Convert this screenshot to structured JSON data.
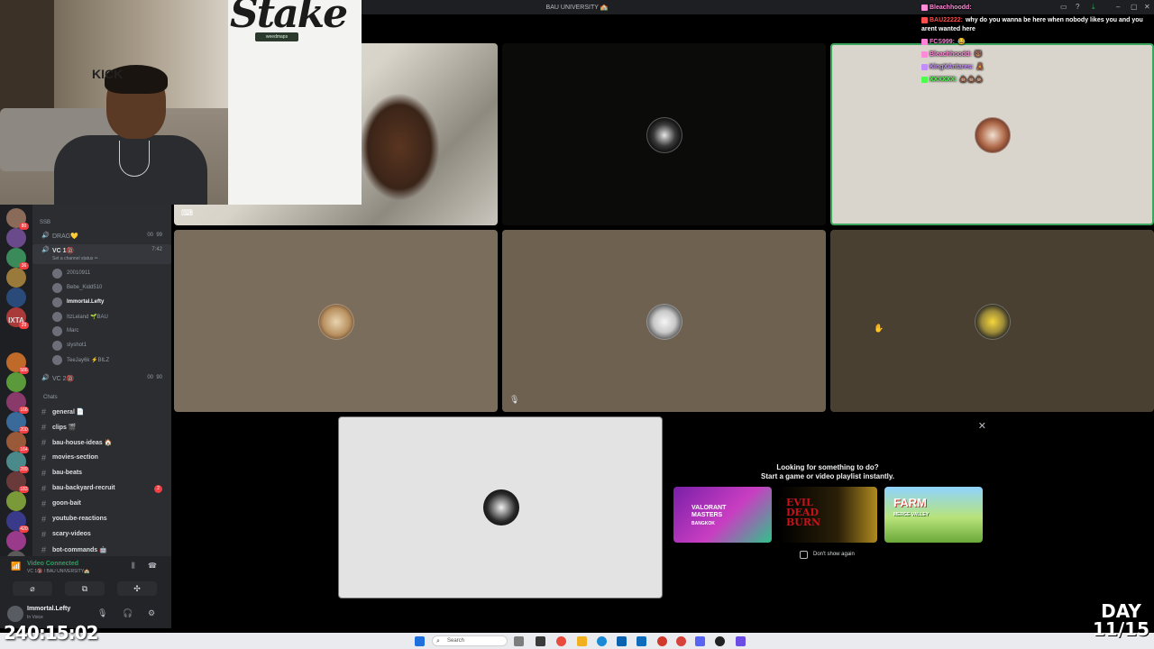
{
  "window": {
    "title": "BAU UNIVERSITY 🏫"
  },
  "webcam": {
    "logo": "Stake",
    "sponsor": "weedmaps",
    "wall_text": "KICK"
  },
  "channels": {
    "header_tag": "SSB",
    "voice": [
      {
        "label": "DRAG💛",
        "count_a": "00",
        "count_b": "99"
      },
      {
        "label": "VC 1🔞",
        "count": "7:42",
        "status": "Set a channel status ✏"
      }
    ],
    "members": [
      {
        "name": "20010911",
        "bright": false
      },
      {
        "name": "Bebe_Kidd510",
        "bright": false
      },
      {
        "name": "Immortal.Lefty",
        "bright": true
      },
      {
        "name": "ItzLeland 🌱BAU",
        "bright": false
      },
      {
        "name": "Marc",
        "bright": false
      },
      {
        "name": "slyshot1",
        "bright": false
      },
      {
        "name": "TeeJay6k ⚡BILZ",
        "bright": false
      }
    ],
    "vc2": {
      "label": "VC 2🔞",
      "count_a": "00",
      "count_b": "90"
    },
    "category": "Chats",
    "text": [
      {
        "label": "general 📄",
        "mention": ""
      },
      {
        "label": "clips 🎬",
        "mention": ""
      },
      {
        "label": "bau-house-ideas 🏠",
        "mention": ""
      },
      {
        "label": "movies-section",
        "mention": ""
      },
      {
        "label": "bau-beats",
        "mention": ""
      },
      {
        "label": "bau-backyard-recruit",
        "mention": "2"
      },
      {
        "label": "goon-bait",
        "mention": ""
      },
      {
        "label": "youtube-reactions",
        "mention": ""
      },
      {
        "label": "scary-videos",
        "mention": ""
      },
      {
        "label": "bot-commands 🤖",
        "mention": ""
      }
    ]
  },
  "guilds": {
    "text_label": "IXTA",
    "badges": [
      "80",
      "",
      "36",
      "",
      "",
      "29",
      "",
      "586",
      "",
      "166",
      "200",
      "164",
      "289",
      "183",
      "",
      "420",
      "",
      "NEW"
    ]
  },
  "voice_bar": {
    "status": "Video Connected",
    "sub": "VC 1🔞 / BAU UNIVERSITY🏫"
  },
  "user": {
    "name": "Immortal.Lefty",
    "status": "In Voice"
  },
  "timer": "240:15:02",
  "day_counter": {
    "line1": "DAY",
    "line2": "11/15"
  },
  "chat": [
    {
      "user": "Bleachhoodd:",
      "text": "",
      "color": "#ff8ad8"
    },
    {
      "user": "BAU22222:",
      "text": "why do you wanna be here when nobody likes you and you arent wanted here",
      "color": "#ff4d4d"
    },
    {
      "user": "FCS999:",
      "text": "😂",
      "color": "#ff7fd9"
    },
    {
      "user": "Bleachhoodd:",
      "text": "🐻",
      "color": "#ff8ad8"
    },
    {
      "user": "KingXAntares:",
      "text": "🧸",
      "color": "#c58cff"
    },
    {
      "user": "XXXXXX:",
      "text": "💩💩💩",
      "color": "#4dff4d"
    }
  ],
  "activity": {
    "heading1": "Looking for something to do?",
    "heading2": "Start a game or video playlist instantly.",
    "games": [
      {
        "title": "VALORANT MASTERS",
        "sub": "BANGKOK"
      },
      {
        "title": "EVIL DEAD BURN",
        "sub": ""
      },
      {
        "title": "FARM",
        "sub": "MERGE VALLEY"
      }
    ],
    "dont_show": "Don't show again"
  },
  "taskbar": {
    "search": "Search"
  },
  "colors": {
    "accent": "#5865f2",
    "green": "#23a55a",
    "danger": "#f23f43"
  }
}
